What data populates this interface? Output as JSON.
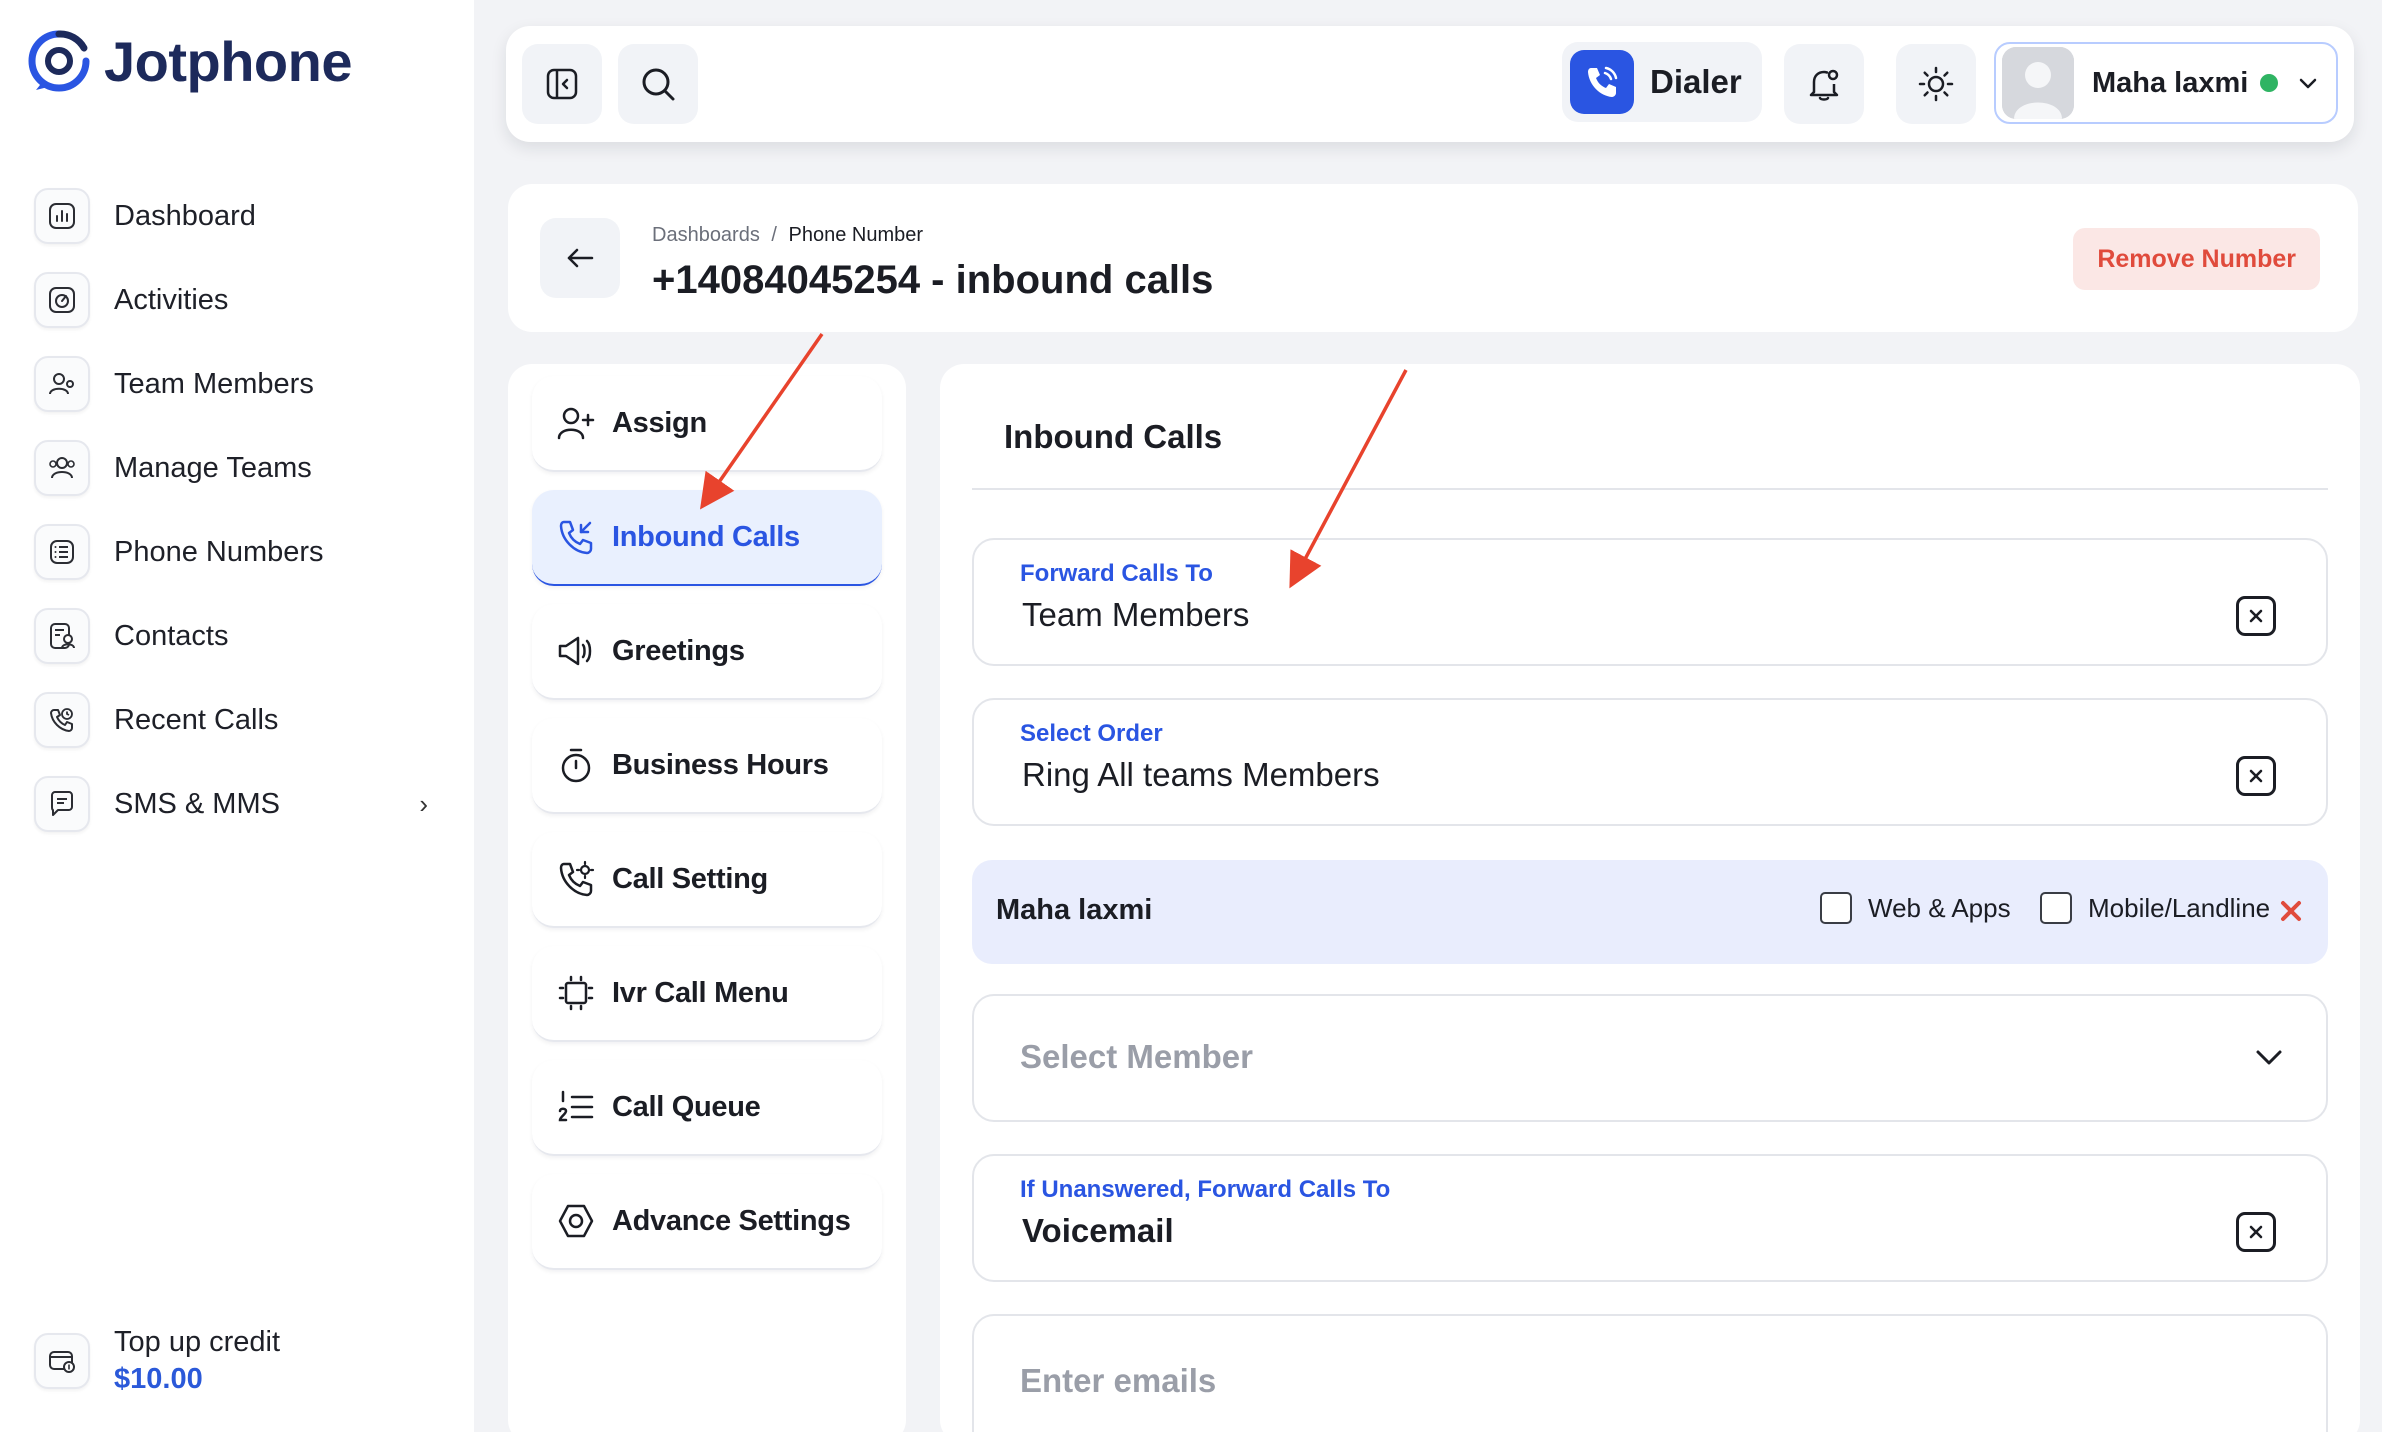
{
  "app": {
    "name": "Jotphone"
  },
  "sidebar": {
    "items": [
      {
        "label": "Dashboard",
        "icon": "dashboard-icon"
      },
      {
        "label": "Activities",
        "icon": "activities-icon"
      },
      {
        "label": "Team Members",
        "icon": "team-members-icon"
      },
      {
        "label": "Manage Teams",
        "icon": "manage-teams-icon"
      },
      {
        "label": "Phone Numbers",
        "icon": "phone-numbers-icon"
      },
      {
        "label": "Contacts",
        "icon": "contacts-icon"
      },
      {
        "label": "Recent Calls",
        "icon": "recent-calls-icon"
      },
      {
        "label": "SMS & MMS",
        "icon": "sms-icon",
        "chevron": "›"
      }
    ],
    "topup": {
      "title": "Top up credit",
      "amount": "$10.00"
    }
  },
  "topbar": {
    "dialer_label": "Dialer",
    "user": {
      "name": "Maha laxmi",
      "status_color": "#2fb463"
    }
  },
  "header": {
    "breadcrumb": {
      "root": "Dashboards",
      "separator": "/",
      "current": "Phone Number"
    },
    "title": "+14084045254 - inbound calls",
    "remove_label": "Remove Number"
  },
  "menu": {
    "items": [
      {
        "label": "Assign",
        "icon": "add-user-icon",
        "active": false
      },
      {
        "label": "Inbound Calls",
        "icon": "inbound-call-icon",
        "active": true
      },
      {
        "label": "Greetings",
        "icon": "megaphone-icon",
        "active": false
      },
      {
        "label": "Business Hours",
        "icon": "timer-icon",
        "active": false
      },
      {
        "label": "Call Setting",
        "icon": "call-settings-icon",
        "active": false
      },
      {
        "label": "Ivr Call Menu",
        "icon": "ivr-icon",
        "active": false
      },
      {
        "label": "Call Queue",
        "icon": "list-icon",
        "active": false
      },
      {
        "label": "Advance Settings",
        "icon": "settings-hex-icon",
        "active": false
      }
    ]
  },
  "content": {
    "title": "Inbound Calls",
    "forward": {
      "label": "Forward Calls To",
      "value": "Team Members"
    },
    "order": {
      "label": "Select Order",
      "value": "Ring All teams Members"
    },
    "member": {
      "name": "Maha laxmi",
      "options": [
        {
          "label": "Web & Apps",
          "checked": false
        },
        {
          "label": "Mobile/Landline",
          "checked": false
        }
      ]
    },
    "select_member": {
      "placeholder": "Select Member"
    },
    "unanswered": {
      "label": "If Unanswered, Forward Calls To",
      "value": "Voicemail"
    },
    "emails": {
      "placeholder": "Enter emails"
    }
  },
  "colors": {
    "accent": "#2a55e2",
    "danger": "#e04b3c",
    "annotation_arrow": "#e8432d"
  }
}
